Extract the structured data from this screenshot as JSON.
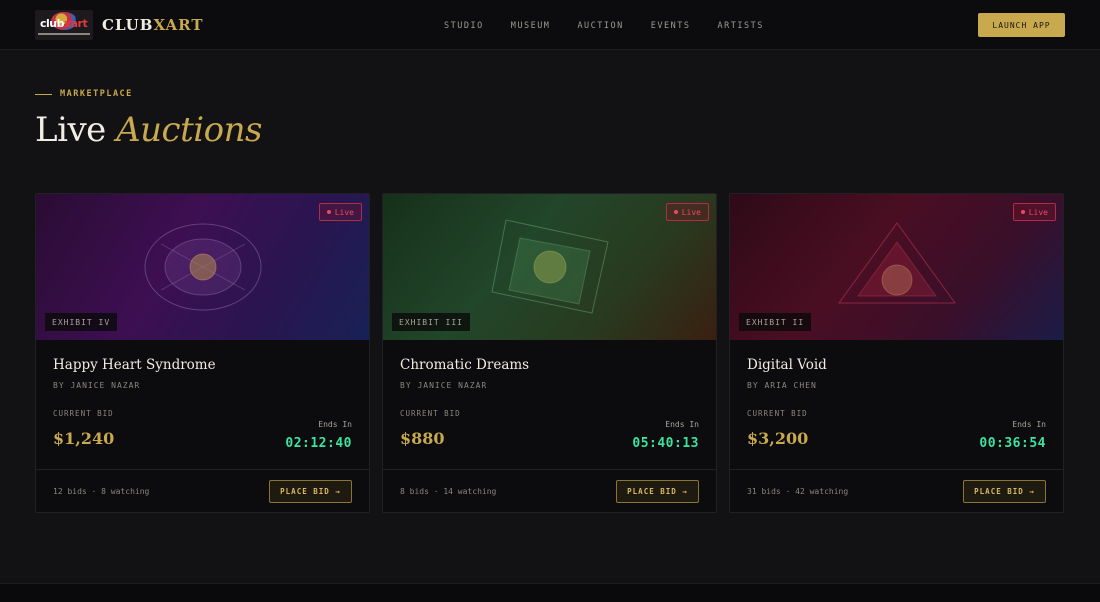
{
  "nav": {
    "logo_text": "club",
    "logo_accent": "xart",
    "brand": "CLUB",
    "brand_accent": "XART",
    "links": [
      "STUDIO",
      "MUSEUM",
      "AUCTION",
      "EVENTS",
      "ARTISTS"
    ],
    "cta": "LAUNCH APP"
  },
  "header": {
    "eyebrow": "MARKETPLACE",
    "title_plain": "Live",
    "title_accent": "Auctions"
  },
  "cards": [
    {
      "status": "Live",
      "exhibit": "EXHIBIT IV",
      "title": "Happy Heart Syndrome",
      "artist": "BY JANICE NAZAR",
      "current_bid_label": "CURRENT BID",
      "current_bid": "$1,240",
      "ends_label": "Ends In",
      "timer": "02:12:40",
      "meta": "12 bids · 8 watching",
      "button": "PLACE BID →"
    },
    {
      "status": "Live",
      "exhibit": "EXHIBIT III",
      "title": "Chromatic Dreams",
      "artist": "BY JANICE NAZAR",
      "current_bid_label": "CURRENT BID",
      "current_bid": "$880",
      "ends_label": "Ends In",
      "timer": "05:40:13",
      "meta": "8 bids · 14 watching",
      "button": "PLACE BID →"
    },
    {
      "status": "Live",
      "exhibit": "EXHIBIT II",
      "title": "Digital Void",
      "artist": "BY ARIA CHEN",
      "current_bid_label": "CURRENT BID",
      "current_bid": "$3,200",
      "ends_label": "Ends In",
      "timer": "00:36:54",
      "meta": "31 bids · 42 watching",
      "button": "PLACE BID →"
    }
  ],
  "colors": {
    "background": "#121113",
    "accent_gold": "#c9a94e",
    "live_red": "#e84a63",
    "timer_green": "#3de3a0"
  }
}
